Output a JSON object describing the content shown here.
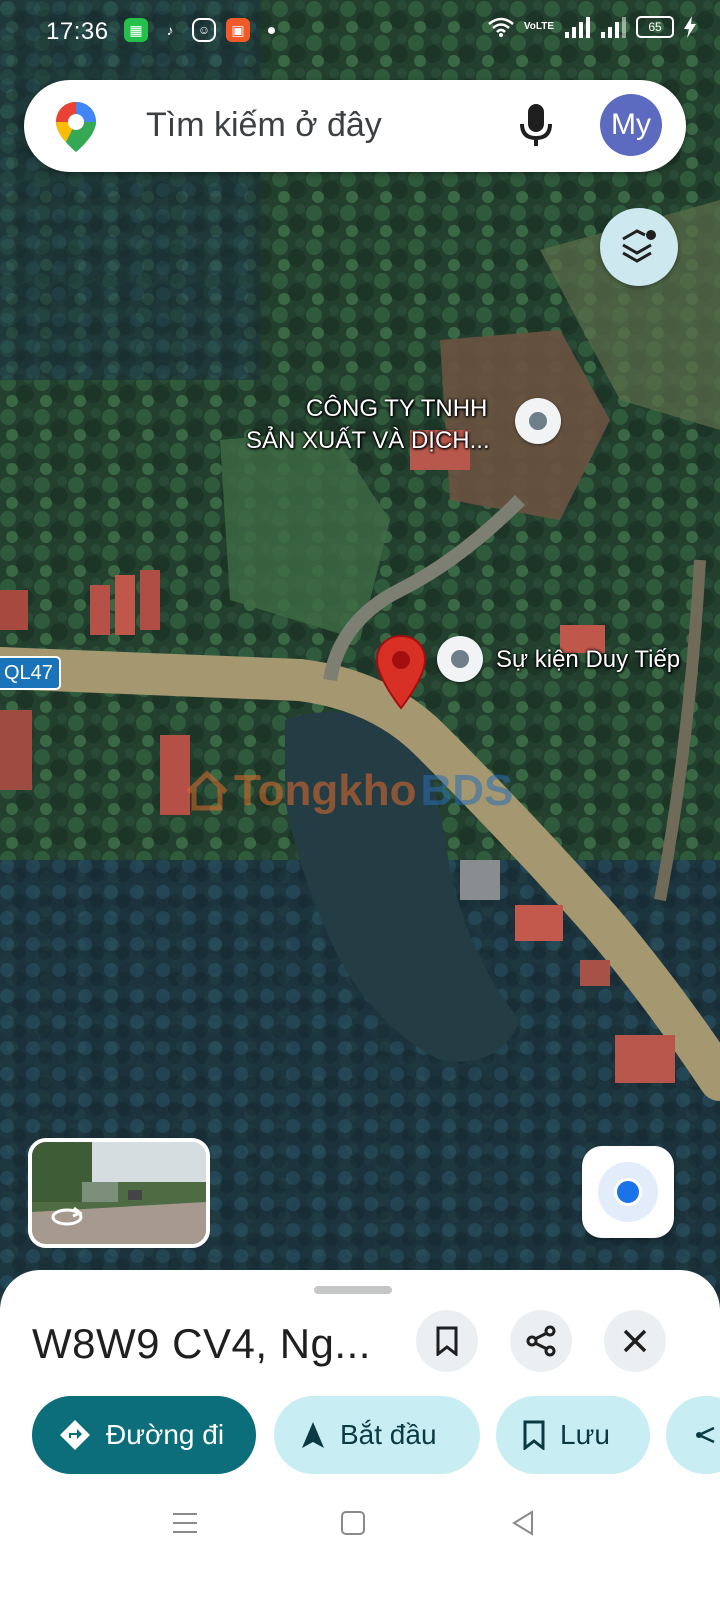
{
  "status_bar": {
    "time": "17:36",
    "battery": "65",
    "network_label": "VoLTE"
  },
  "search": {
    "placeholder": "Tìm kiếm ở đây",
    "avatar_initials": "My"
  },
  "map": {
    "labels": {
      "company_line1": "CÔNG TY TNHH",
      "company_line2": "SẢN XUẤT VÀ DỊCH...",
      "event_place": "Sự kiện Duy Tiếp",
      "road_shield": "QL47"
    },
    "watermark": {
      "part1": "Tongkho",
      "part2": "BDS"
    }
  },
  "place": {
    "title": "W8W9 CV4, Ng..."
  },
  "actions": {
    "directions": "Đường đi",
    "start": "Bắt đầu",
    "save": "Lưu"
  },
  "colors": {
    "primary_chip": "#0b6e7a",
    "secondary_chip": "#c8edf3",
    "marker_red": "#d93025",
    "location_blue": "#1a73e8"
  }
}
